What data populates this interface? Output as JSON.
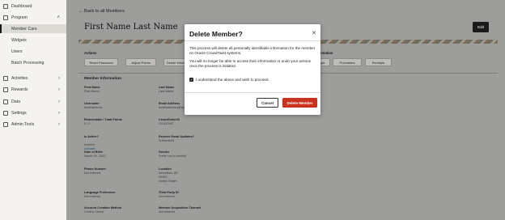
{
  "sidebar": {
    "items": [
      {
        "label": "Dashboard"
      },
      {
        "label": "Program"
      },
      {
        "label": "Member Care"
      },
      {
        "label": "Widgets"
      },
      {
        "label": "Users"
      },
      {
        "label": "Batch Processing"
      },
      {
        "label": "Activities"
      },
      {
        "label": "Rewards"
      },
      {
        "label": "Data"
      },
      {
        "label": "Settings"
      },
      {
        "label": "Admin Tools"
      }
    ]
  },
  "header": {
    "back_label": "Back to all Members",
    "member_name": "First Name Last Name",
    "edit_label": "Edit"
  },
  "actions": {
    "section_label": "Actions",
    "buttons": [
      "Reset Password",
      "Adjust Points",
      "Delete Member",
      "Purchases",
      "Receipts"
    ],
    "hidden_button_suffix": "ger",
    "info_suffix": "rmation"
  },
  "member_info": {
    "section_label": "Member Information",
    "fields": [
      {
        "label": "First Name",
        "value": "First Name"
      },
      {
        "label": "Last Name",
        "value": "Last Name"
      },
      {
        "label": "Username",
        "value": "emailaddress"
      },
      {
        "label": "Email Address",
        "value": "emailaddress@fake"
      },
      {
        "label": "Redeemable / Total Points",
        "value": "0 / 0"
      },
      {
        "label": "CrowdTwist ID",
        "value": "211437687"
      },
      {
        "label": "Is Active?",
        "value": "Inactive",
        "link": "Activate"
      },
      {
        "label": "Receive Email Updates?",
        "value": "Subscribed"
      },
      {
        "label": "Date of Birth",
        "value": "March 30, 2003"
      },
      {
        "label": "Gender",
        "value": "Prefer not to identify"
      },
      {
        "label": "Phone Number",
        "value": "Not entered"
      },
      {
        "label": "Location",
        "value": "Ketchikan, AK\n99950\nUnited States"
      },
      {
        "label": "Language Preference",
        "value": "Not entered"
      },
      {
        "label": "Third Party ID",
        "value": "Not entered"
      },
      {
        "label": "Account Creation Method",
        "value": "Control Center"
      },
      {
        "label": "Member Acquisition Channel",
        "value": "Not entered"
      }
    ]
  },
  "modal": {
    "title": "Delete Member?",
    "close_icon": "close-icon",
    "paragraph1": "This process will delete all personally identifiable information for the member on Oracle CrowdTwist systems.",
    "paragraph2": "You will no longer be able to access their information or undo your actions once the process is initiated.",
    "checkbox_label": "I understand the above and wish to proceed.",
    "checkbox_checked": true,
    "cancel_label": "Cancel",
    "delete_label": "Delete Member"
  },
  "colors": {
    "delete_button": "#c8321f",
    "edit_button": "#1a1a1a",
    "overlay": "#9d9d9b"
  }
}
